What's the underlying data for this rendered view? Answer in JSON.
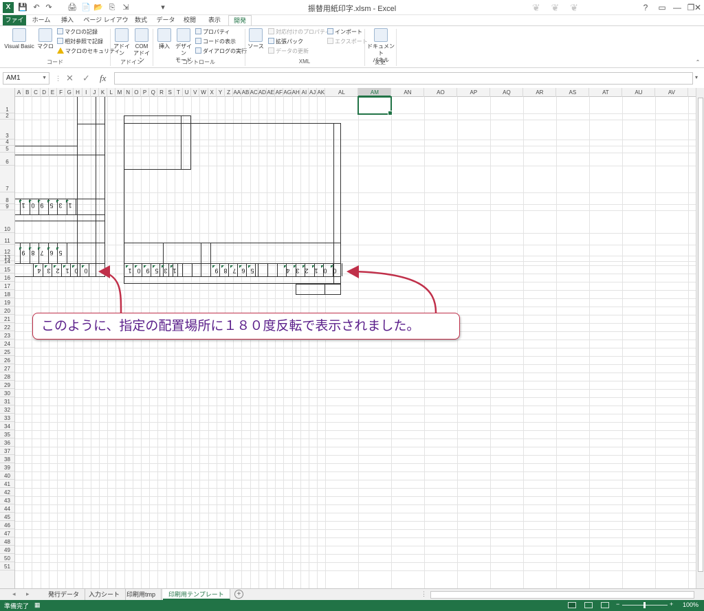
{
  "window": {
    "title": "振替用紙印字.xlsm - Excel",
    "help_glyph": "?",
    "decor": "❦ ❦ ❦"
  },
  "quick_access": [
    "💾",
    "↶",
    "↷",
    "🖨",
    "📄",
    "📂",
    "⎘",
    "⇲",
    "▾"
  ],
  "tabs": [
    "ファイル",
    "ホーム",
    "挿入",
    "ページ レイアウト",
    "数式",
    "データ",
    "校閲",
    "表示",
    "開発"
  ],
  "active_tab": "開発",
  "ribbon": {
    "code": {
      "label": "コード",
      "visual_basic": "Visual Basic",
      "macro": "マクロ",
      "record_macro": "マクロの記録",
      "relative_ref": "相対参照で記録",
      "macro_security": "マクロのセキュリティ"
    },
    "addins": {
      "label": "アドイン",
      "addin": "アドイン",
      "com_addin_line1": "COM",
      "com_addin_line2": "アドイン"
    },
    "controls": {
      "label": "コントロール",
      "insert": "挿入",
      "design_mode_line1": "デザイン",
      "design_mode_line2": "モード",
      "properties": "プロパティ",
      "view_code": "コードの表示",
      "run_dialog": "ダイアログの実行"
    },
    "xml": {
      "label": "XML",
      "source": "ソース",
      "map_properties": "対応付けのプロパティ",
      "expansion_packs": "拡張パック",
      "refresh_data": "データの更新",
      "import": "インポート",
      "export": "エクスポート"
    },
    "modify": {
      "label": "変更",
      "doc_panel_line1": "ドキュメント",
      "doc_panel_line2": "パネル"
    }
  },
  "formula_bar": {
    "name_box": "AM1",
    "fx": "fx",
    "formula": ""
  },
  "columns_narrow": [
    "A",
    "B",
    "C",
    "D",
    "E",
    "F",
    "G",
    "H",
    "I",
    "J",
    "K",
    "L",
    "M",
    "N",
    "O",
    "P",
    "Q",
    "R",
    "S",
    "T",
    "U",
    "V",
    "W",
    "X",
    "Y",
    "Z",
    "AA",
    "AB",
    "AC",
    "AD",
    "AE",
    "AF",
    "AG",
    "AH",
    "AI",
    "AJ",
    "AK"
  ],
  "columns_wide": [
    "AL",
    "AM",
    "AN",
    "AO",
    "AP",
    "AQ",
    "AR",
    "AS",
    "AT",
    "AU",
    "AV"
  ],
  "selected_column": "AM",
  "rows_visible": 51,
  "rotated_digits": {
    "left_row8": [
      "1",
      "0",
      "9",
      "5",
      "3",
      "1"
    ],
    "left_row11": [
      "9",
      "8",
      "7",
      "6",
      "5"
    ],
    "left_row12": [
      "4",
      "3",
      "2",
      "1",
      "0",
      "0"
    ],
    "mid_row12_a": [
      "1",
      "0",
      "9",
      "5",
      "3",
      "1"
    ],
    "mid_row12_b": [
      "9",
      "8",
      "7",
      "6",
      "5"
    ],
    "right_row12": [
      "4",
      "3",
      "2",
      "1",
      "0",
      "0"
    ]
  },
  "annotation": {
    "text": "このように、指定の配置場所に１８０度反転で表示されました。",
    "color": "#c0304a"
  },
  "sheet_tabs": [
    "発行データ",
    "入力シート",
    "印刷用tmp",
    "印刷用テンプレート"
  ],
  "active_sheet": "印刷用テンプレート",
  "status": {
    "ready": "準備完了",
    "zoom": "100%"
  },
  "colors": {
    "excel_green": "#217346",
    "annotation_red": "#c0304a",
    "annotation_text": "#5a1e8a"
  }
}
